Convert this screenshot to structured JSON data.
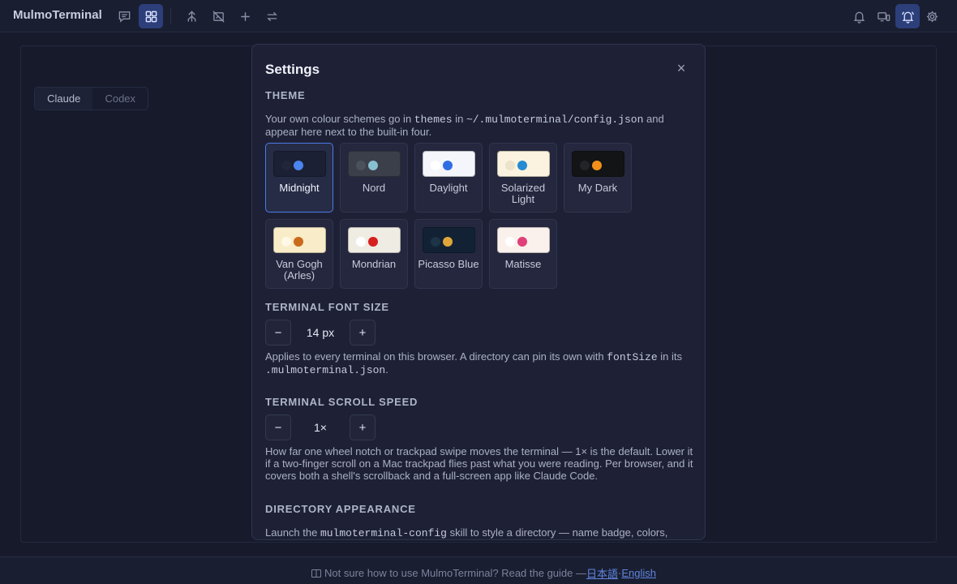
{
  "app": {
    "title": "MulmoTerminal"
  },
  "toolbar": {
    "icons": [
      "chat-icon",
      "grid-icon",
      "merge-icon",
      "no-image-icon",
      "plus-icon",
      "swap-icon",
      "bell-icon",
      "devices-icon",
      "bell-ring-icon",
      "gear-icon"
    ]
  },
  "tabs": [
    {
      "label": "Claude"
    },
    {
      "label": "Codex"
    }
  ],
  "settings": {
    "title": "Settings",
    "close": "×",
    "theme": {
      "heading": "THEME",
      "desc_1": "Your own colour schemes go in ",
      "desc_code_1": "themes",
      "desc_2": " in ",
      "desc_code_2": "~/.mulmoterminal/config.json",
      "desc_3": " and appear here next to the built-in four.",
      "items": [
        {
          "name": "Midnight",
          "bg": "#1c2034",
          "dot1": "#22263a",
          "dot2": "#4a85f0",
          "selected": true
        },
        {
          "name": "Nord",
          "bg": "#3b3f4a",
          "dot1": "#4b505d",
          "dot2": "#88c0d0"
        },
        {
          "name": "Daylight",
          "bg": "#f4f6fb",
          "dot1": "#ffffff",
          "dot2": "#2f6ee2"
        },
        {
          "name": "Solarized Light",
          "bg": "#fbf3df",
          "dot1": "#ece3cc",
          "dot2": "#268bd2"
        },
        {
          "name": "My Dark",
          "bg": "#121416",
          "dot1": "#222528",
          "dot2": "#f0901a"
        },
        {
          "name": "Van Gogh (Arles)",
          "bg": "#f9ecc8",
          "dot1": "#fff8e6",
          "dot2": "#c96a1c"
        },
        {
          "name": "Mondrian",
          "bg": "#efece4",
          "dot1": "#ffffff",
          "dot2": "#d61f1f"
        },
        {
          "name": "Picasso Blue",
          "bg": "#122234",
          "dot1": "#1d3346",
          "dot2": "#e0a63a"
        },
        {
          "name": "Matisse",
          "bg": "#fbf1ec",
          "dot1": "#ffffff",
          "dot2": "#e0407a"
        }
      ]
    },
    "font_size": {
      "heading": "TERMINAL FONT SIZE",
      "minus": "−",
      "value": "14 px",
      "plus": "+",
      "desc_1": "Applies to every terminal on this browser. A directory can pin its own with ",
      "desc_code_1": "fontSize",
      "desc_2": " in its ",
      "desc_code_2": ".mulmoterminal.json",
      "desc_3": "."
    },
    "scroll_speed": {
      "heading": "TERMINAL SCROLL SPEED",
      "minus": "−",
      "value": "1×",
      "plus": "+",
      "desc": "How far one wheel notch or trackpad swipe moves the terminal — 1× is the default. Lower it if a two-finger scroll on a Mac trackpad flies past what you were reading. Per browser, and it covers both a shell's scrollback and a full-screen app like Claude Code."
    },
    "directory": {
      "heading": "DIRECTORY APPEARANCE",
      "desc_1": "Launch the ",
      "desc_code_1": "mulmoterminal-config",
      "desc_2": " skill to style a directory — name badge, colors,"
    }
  },
  "footer": {
    "text": "Not sure how to use MulmoTerminal? Read the guide — ",
    "link_ja": "日本語",
    "sep": " · ",
    "link_en": "English"
  }
}
